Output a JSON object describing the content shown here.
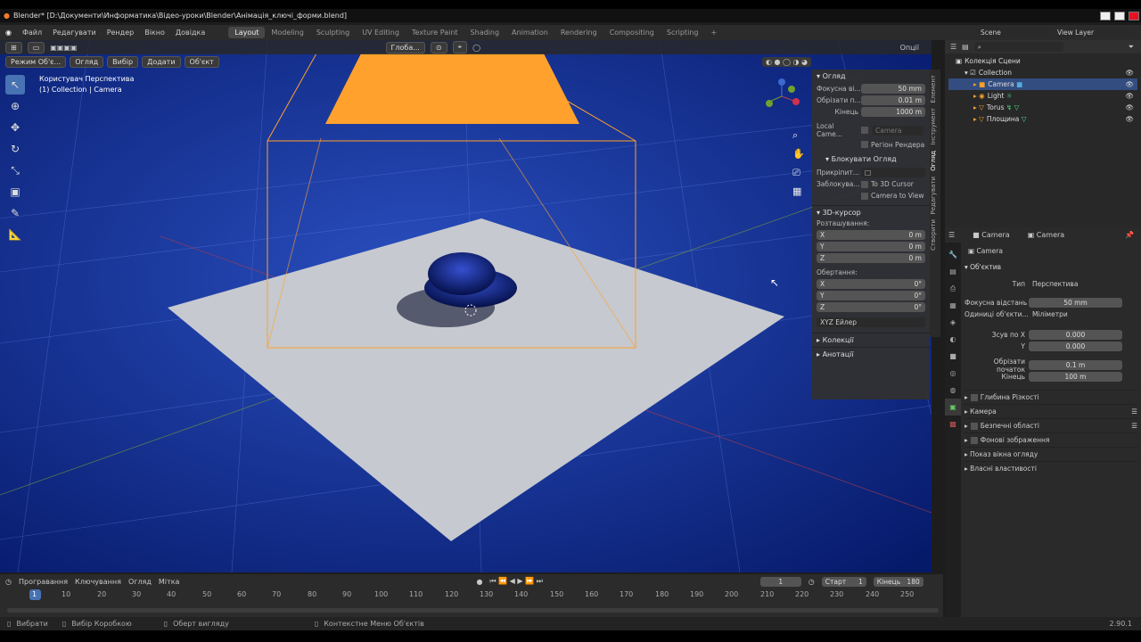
{
  "title": "Blender* [D:\\Документи\\Информатика\\Відео-уроки\\Blender\\Анімація_ключі_форми.blend]",
  "menu": [
    "Файл",
    "Редагувати",
    "Рендер",
    "Вікно",
    "Довідка"
  ],
  "tabs": [
    "Layout",
    "Modeling",
    "Sculpting",
    "UV Editing",
    "Texture Paint",
    "Shading",
    "Animation",
    "Rendering",
    "Compositing",
    "Scripting"
  ],
  "scene": "Scene",
  "view_layer": "View Layer",
  "viewport": {
    "mode": "Режим Об'є...",
    "menus": [
      "Огляд",
      "Вибір",
      "Додати",
      "Об'єкт"
    ],
    "overlay_title": "Користувач Перспектива",
    "overlay_sub": "(1) Collection | Camera",
    "transform": "Глоба...",
    "options": "Опції"
  },
  "npanel": {
    "view_header": "Огляд",
    "focal_label": "Фокусна ві...",
    "focal": "50 mm",
    "clip_start_label": "Обрізати п...",
    "clip_start": "0.01 m",
    "clip_end_label": "Кінець",
    "clip_end": "1000 m",
    "local_camera_label": "Local Came...",
    "local_camera": "Camera",
    "render_region": "Регіон Рендера",
    "lock_header": "Блокувати Огляд",
    "pin_label": "Прикріпит...",
    "lock_label": "Заблокува...",
    "to_cursor": "To 3D Cursor",
    "cam_to_view": "Camera to View",
    "cursor_header": "3D-курсор",
    "location_label": "Розташування:",
    "loc": [
      {
        "axis": "X",
        "val": "0 m"
      },
      {
        "axis": "Y",
        "val": "0 m"
      },
      {
        "axis": "Z",
        "val": "0 m"
      }
    ],
    "rotation_label": "Обертання:",
    "rot": [
      {
        "axis": "X",
        "val": "0°"
      },
      {
        "axis": "Y",
        "val": "0°"
      },
      {
        "axis": "Z",
        "val": "0°"
      }
    ],
    "rot_mode": "XYZ Ейлер",
    "collections": "Колекції",
    "annotations": "Анотації",
    "side_tabs": [
      "Елемент",
      "Інструмент",
      "Огляд",
      "Редагувати",
      "Створити"
    ]
  },
  "outliner": {
    "root": "Колекція Сцени",
    "items": [
      "Collection",
      "Camera",
      "Light",
      "Torus",
      "Площина"
    ]
  },
  "props": {
    "obj": "Camera",
    "data": "Camera",
    "datablock": "Camera",
    "lens_header": "Об'єктив",
    "type_label": "Тип",
    "type": "Перспектива",
    "focal_label": "Фокусна відстань",
    "focal": "50 mm",
    "units_label": "Одиниці об'єкти...",
    "units": "Міліметри",
    "shiftx_label": "Зсув по X",
    "shiftx": "0.000",
    "shifty_label": "Y",
    "shifty": "0.000",
    "clip_start_label": "Обрізати початок",
    "clip_start": "0.1 m",
    "clip_end_label": "Кінець",
    "clip_end": "100 m",
    "sections": [
      "Глибина Різкості",
      "Камера",
      "Безпечні області",
      "Фонові зображення",
      "Показ вікна огляду",
      "Власні властивості"
    ]
  },
  "timeline": {
    "menus": [
      "Програвання",
      "Ключування",
      "Огляд",
      "Мітка"
    ],
    "frame": "1",
    "start_label": "Старт",
    "start": "1",
    "end_label": "Кінець",
    "end": "180",
    "ticks": [
      "1",
      "10",
      "20",
      "30",
      "40",
      "50",
      "60",
      "70",
      "80",
      "90",
      "100",
      "110",
      "120",
      "130",
      "140",
      "150",
      "160",
      "170",
      "180",
      "190",
      "200",
      "210",
      "220",
      "230",
      "240",
      "250"
    ]
  },
  "status": {
    "select": "Вибрати",
    "box": "Вибір Коробкою",
    "rotate": "Оберт вигляду",
    "context": "Контекстне Меню Об'єктів",
    "version": "2.90.1"
  },
  "colors": {
    "accent": "#4772b3",
    "camera_orange": "#ffa12c",
    "viewport_bg": "#0f2c8c"
  }
}
